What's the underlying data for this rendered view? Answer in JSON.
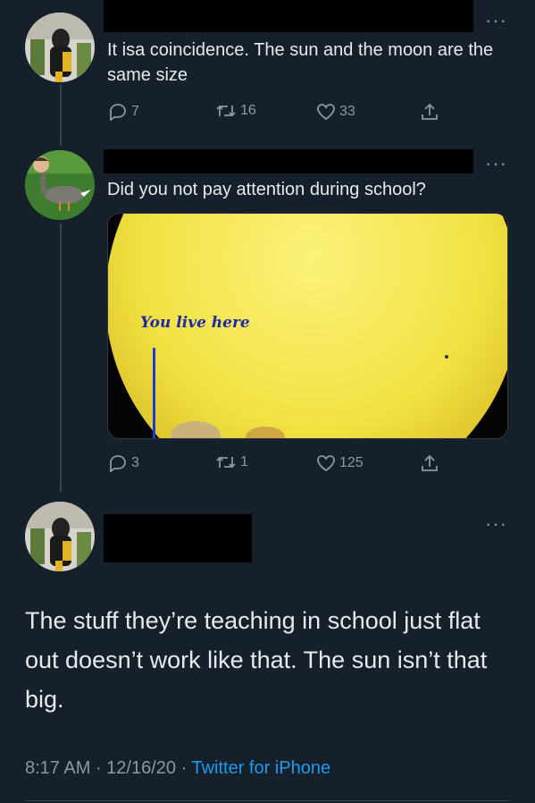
{
  "theme": {
    "bg": "#15202b",
    "text": "#e7e9ea",
    "muted": "#8b98a5",
    "link": "#1d9bf0",
    "sun": "#f4e44a"
  },
  "tweets": [
    {
      "text": "It isa coincidence. The sun and the moon are the same size",
      "replies": "7",
      "retweets": "16",
      "likes": "33",
      "avatar_icon": "profile-avatar"
    },
    {
      "text": "Did you not pay attention during school?",
      "replies": "3",
      "retweets": "1",
      "likes": "125",
      "avatar_icon": "goose-avatar",
      "media": {
        "caption": "You live here"
      }
    }
  ],
  "main_tweet": {
    "text": "The stuff they’re teaching in school just flat out doesn’t work like that. The sun isn’t that big.",
    "time": "8:17 AM",
    "date": "12/16/20",
    "separator": " · ",
    "source": "Twitter for iPhone"
  },
  "more_label": "···"
}
